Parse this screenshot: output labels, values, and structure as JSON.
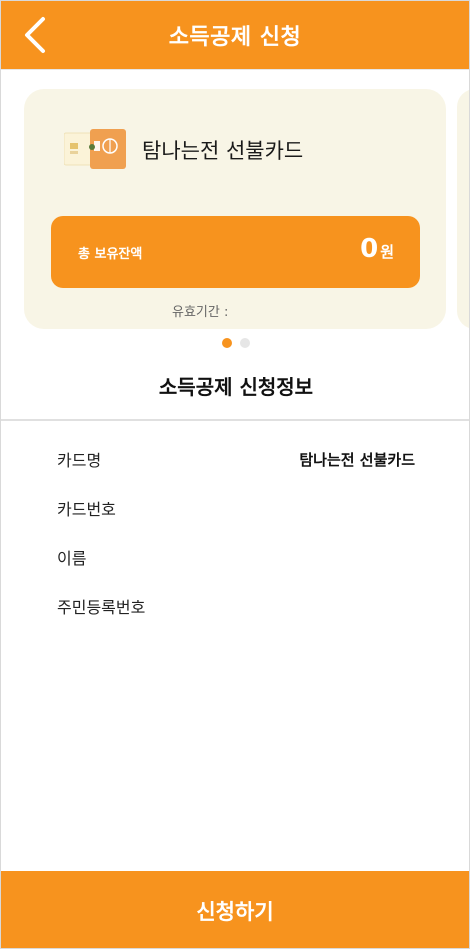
{
  "header": {
    "title": "소득공제 신청",
    "back_icon": "chevron-left-icon"
  },
  "colors": {
    "accent": "#f7931e",
    "card_bg": "#f8f5e6"
  },
  "card": {
    "name": "탐나는전 선불카드",
    "balance_label": "총 보유잔액",
    "balance_amount": "0",
    "balance_unit": "원",
    "validity_label": "유효기간 :"
  },
  "carousel": {
    "pages": 2,
    "active_index": 0
  },
  "section": {
    "title": "소득공제 신청정보"
  },
  "info_rows": [
    {
      "label": "카드명",
      "value": "탐나는전 선불카드"
    },
    {
      "label": "카드번호",
      "value": ""
    },
    {
      "label": "이름",
      "value": ""
    },
    {
      "label": "주민등록번호",
      "value": ""
    }
  ],
  "footer": {
    "submit_label": "신청하기"
  }
}
